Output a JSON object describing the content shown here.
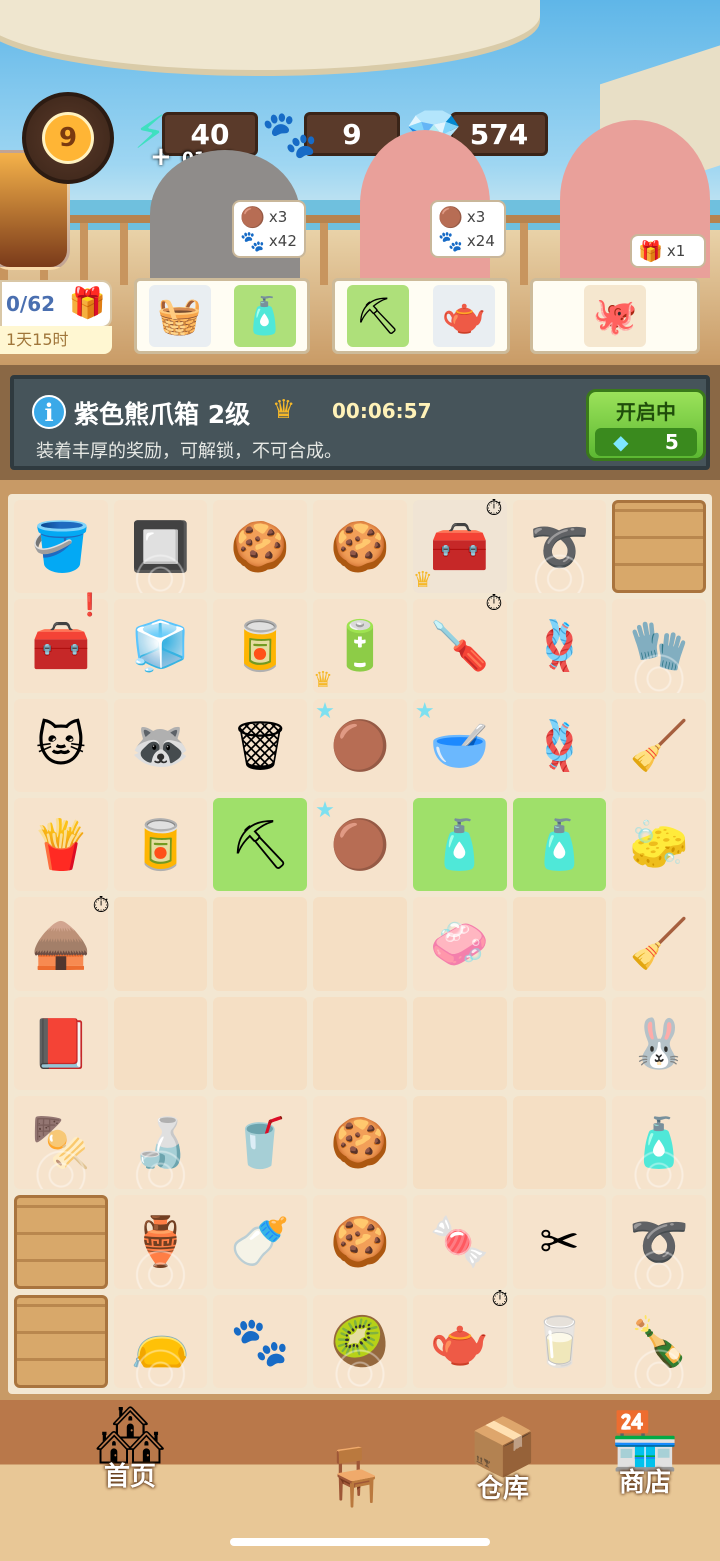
{
  "hud": {
    "level": "9",
    "energy": {
      "value": "40",
      "timer": "01:33",
      "icon": "lightning-icon"
    },
    "paws": {
      "value": "9",
      "icon": "paw-icon"
    },
    "gems": {
      "value": "574",
      "icon": "diamond-icon"
    }
  },
  "orders": [
    {
      "character": "raccoon",
      "reward_items": [
        {
          "icon": "coffee-bean-icon",
          "count": "x3"
        },
        {
          "icon": "paw-icon",
          "count": "x42"
        }
      ]
    },
    {
      "character": "girl",
      "reward_items": [
        {
          "icon": "coffee-bean-icon",
          "count": "x3"
        },
        {
          "icon": "paw-icon",
          "count": "x24"
        }
      ]
    },
    {
      "character": "girl",
      "reward_items": [
        {
          "icon": "gift-box-icon",
          "count": "x1"
        }
      ]
    }
  ],
  "progress": {
    "text": "0/62",
    "time_left": "1天15时"
  },
  "info": {
    "title": "紫色熊爪箱 2级",
    "timer": "00:06:57",
    "description": "装着丰厚的奖励，可解锁，不可合成。",
    "button": {
      "label": "开启中",
      "cost": "5"
    }
  },
  "nav": {
    "home": "首页",
    "warehouse": "仓库",
    "shop": "商店"
  }
}
